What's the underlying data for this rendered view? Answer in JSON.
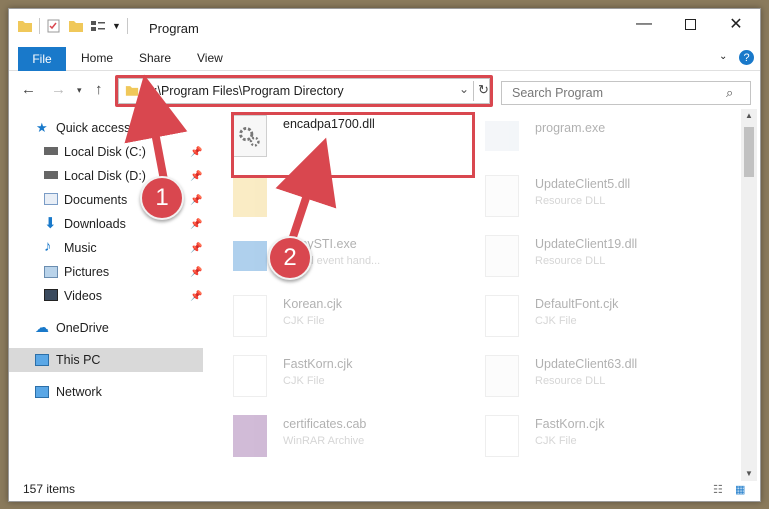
{
  "window": {
    "title": "Program"
  },
  "ribbon": {
    "file": "File",
    "home": "Home",
    "share": "Share",
    "view": "View"
  },
  "address": {
    "path": "C:\\Program Files\\Program Directory"
  },
  "search": {
    "placeholder": "Search Program"
  },
  "sidebar": {
    "items": [
      {
        "label": "Quick access",
        "icon": "star-icon"
      },
      {
        "label": "Local Disk (C:)",
        "icon": "drive-icon",
        "pinned": true
      },
      {
        "label": "Local Disk (D:)",
        "icon": "drive-icon",
        "pinned": true
      },
      {
        "label": "Documents",
        "icon": "document-icon",
        "pinned": true
      },
      {
        "label": "Downloads",
        "icon": "download-icon",
        "pinned": true
      },
      {
        "label": "Music",
        "icon": "music-icon",
        "pinned": true
      },
      {
        "label": "Pictures",
        "icon": "pictures-icon",
        "pinned": true
      },
      {
        "label": "Videos",
        "icon": "video-icon",
        "pinned": true
      },
      {
        "label": "OneDrive",
        "icon": "cloud-icon"
      },
      {
        "label": "This PC",
        "icon": "computer-icon",
        "selected": true
      },
      {
        "label": "Network",
        "icon": "network-icon"
      }
    ]
  },
  "files": [
    {
      "name": "encadpa1700.dll",
      "type": "",
      "icon": "dll-gear-icon"
    },
    {
      "name": "program.exe",
      "type": "",
      "icon": "exe-icon"
    },
    {
      "name": "d...",
      "type": "",
      "icon": "folder-icon"
    },
    {
      "name": "UpdateClient5.dll",
      "type": "Resource DLL",
      "icon": "dll-gear-icon"
    },
    {
      "name": "...ppySTI.exe",
      "type": "...or id event hand...",
      "icon": "exe-icon"
    },
    {
      "name": "UpdateClient19.dll",
      "type": "Resource DLL",
      "icon": "dll-gear-icon"
    },
    {
      "name": "Korean.cjk",
      "type": "CJK File",
      "icon": "file-icon"
    },
    {
      "name": "DefaultFont.cjk",
      "type": "CJK File",
      "icon": "file-icon"
    },
    {
      "name": "FastKorn.cjk",
      "type": "CJK File",
      "icon": "file-icon"
    },
    {
      "name": "UpdateClient63.dll",
      "type": "Resource DLL",
      "icon": "dll-gear-icon"
    },
    {
      "name": "certificates.cab",
      "type": "WinRAR Archive",
      "icon": "archive-icon"
    },
    {
      "name": "FastKorn.cjk",
      "type": "CJK File",
      "icon": "file-icon"
    }
  ],
  "status": {
    "count": "157 items"
  },
  "callouts": {
    "one": "1",
    "two": "2"
  },
  "colors": {
    "accent": "#1979ca",
    "highlight": "#d9474f"
  }
}
